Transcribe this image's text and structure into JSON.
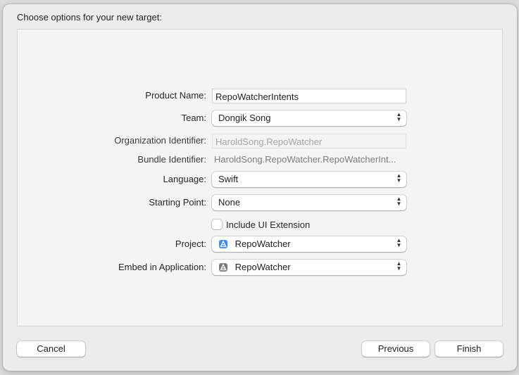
{
  "dialog": {
    "title": "Choose options for your new target:"
  },
  "form": {
    "product_name": {
      "label": "Product Name:",
      "value": "RepoWatcherIntents"
    },
    "team": {
      "label": "Team:",
      "value": "Dongik Song"
    },
    "organization_identifier": {
      "label": "Organization Identifier:",
      "value": "HaroldSong.RepoWatcher"
    },
    "bundle_identifier": {
      "label": "Bundle Identifier:",
      "value": "HaroldSong.RepoWatcher.RepoWatcherInt..."
    },
    "language": {
      "label": "Language:",
      "value": "Swift"
    },
    "starting_point": {
      "label": "Starting Point:",
      "value": "None"
    },
    "include_ui_extension": {
      "label": "Include UI Extension",
      "checked": false
    },
    "project": {
      "label": "Project:",
      "value": "RepoWatcher",
      "icon": "xcode-project-icon",
      "icon_color": "#3d8bf0"
    },
    "embed_in_application": {
      "label": "Embed in Application:",
      "value": "RepoWatcher",
      "icon": "app-target-icon",
      "icon_color": "#7b7b7b"
    }
  },
  "buttons": {
    "cancel": "Cancel",
    "previous": "Previous",
    "finish": "Finish"
  }
}
